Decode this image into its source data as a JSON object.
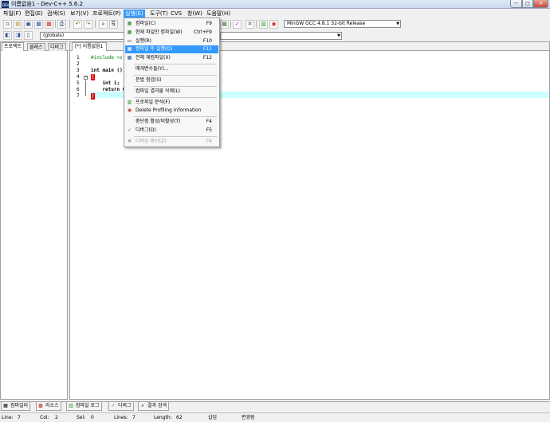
{
  "window": {
    "icon_text": "DEV",
    "title": "이름없음1 - Dev-C++ 5.6.2",
    "min_glyph": "─",
    "max_glyph": "□",
    "close_glyph": "✕"
  },
  "menubar": {
    "items": [
      "파일(F)",
      "편집(E)",
      "검색(S)",
      "보기(V)",
      "프로젝트(P)",
      "실행(E)",
      "도구(T)",
      "CVS",
      "창(W)",
      "도움말(H)"
    ]
  },
  "toolbar": {
    "compiler_select": "MinGW GCC 4.8.1 32-bit Release",
    "scope_select": "(globals)",
    "icons": {
      "new": "new-file-icon",
      "open": "open-file-icon",
      "save": "save-icon",
      "save_all": "save-all-icon",
      "close": "close-file-icon",
      "print": "print-icon",
      "undo": "undo-icon",
      "redo": "redo-icon",
      "find": "find-icon",
      "replace": "replace-icon",
      "check": "check-syntax-icon",
      "stop": "stop-icon",
      "chart": "profile-chart-icon",
      "compile_run": "compile-run-icon"
    }
  },
  "left_panel": {
    "tabs": [
      "프로젝트",
      "클래스",
      "디버그"
    ]
  },
  "editor": {
    "file_tab": "[*] 이름없음1",
    "line_numbers": [
      "1",
      "2",
      "3",
      "4",
      "5",
      "6",
      "7"
    ],
    "lines": [
      {
        "text": "#include <stdio.h>"
      },
      {
        "text": ""
      },
      {
        "text": "int main ()"
      },
      {
        "text": "{"
      },
      {
        "text": "    int i;"
      },
      {
        "text": "    return 0;"
      },
      {
        "text": "}"
      }
    ],
    "brace_open": "{",
    "brace_close": "}"
  },
  "run_menu": {
    "items": [
      {
        "icon": "compile-icon",
        "label": "컴파일(C)",
        "shortcut": "F9"
      },
      {
        "icon": "compile-file-icon",
        "label": "현재 파일만 컴파일(W)",
        "shortcut": "Ctrl+F9"
      },
      {
        "icon": "run-icon",
        "label": "실행(R)",
        "shortcut": "F10"
      },
      {
        "icon": "compile-run-icon",
        "label": "컴파일 후 실행(O)",
        "shortcut": "F11"
      },
      {
        "icon": "rebuild-icon",
        "label": "전체 재컴파일(X)",
        "shortcut": "F12"
      },
      {
        "icon": "",
        "label": "매개변수들(Y)...",
        "shortcut": ""
      },
      {
        "icon": "",
        "label": "문법 점검(S)",
        "shortcut": ""
      },
      {
        "icon": "",
        "label": "컴파일 결과물 삭제(L)",
        "shortcut": ""
      },
      {
        "icon": "profile-chart-icon",
        "label": "프로파일 분석(F)",
        "shortcut": ""
      },
      {
        "icon": "delete-profiling-icon",
        "label": "Delete Profiling Information",
        "shortcut": ""
      },
      {
        "icon": "",
        "label": "중단점 활성/비활성(T)",
        "shortcut": "F4"
      },
      {
        "icon": "debug-check-icon",
        "label": "디버그(D)",
        "shortcut": "F5"
      },
      {
        "icon": "stop-debug-icon",
        "label": "디버깅 중단(Z)",
        "shortcut": "F6"
      }
    ]
  },
  "bottom_tabs": [
    {
      "icon": "compiler-icon",
      "label": "컴파일러"
    },
    {
      "icon": "resources-icon",
      "label": "리소스"
    },
    {
      "icon": "compile-log-icon",
      "label": "컴파일 로그"
    },
    {
      "icon": "debug-icon",
      "label": "디버그"
    },
    {
      "icon": "find-results-icon",
      "label": "결과 검색"
    }
  ],
  "statusbar": {
    "line_label": "Line:",
    "line_value": "7",
    "col_label": "Col:",
    "col_value": "2",
    "sel_label": "Sel:",
    "sel_value": "0",
    "lines_label": "Lines:",
    "lines_value": "7",
    "length_label": "Length:",
    "length_value": "62",
    "mode": "삽입",
    "modified": "변경됨"
  },
  "colors": {
    "highlight": "#3399ff",
    "current_line": "#ccffff",
    "brace_mark": "#e00000"
  }
}
